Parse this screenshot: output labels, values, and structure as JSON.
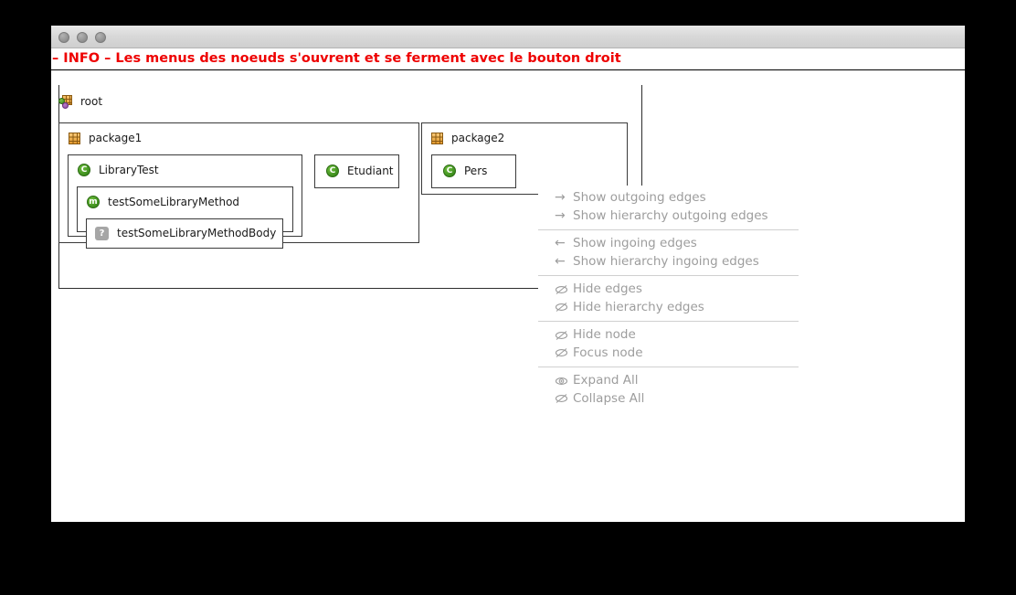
{
  "window": {
    "traffic_lights": [
      "close",
      "minimize",
      "maximize"
    ],
    "info_message": "– INFO – Les menus des noeuds s'ouvrent et se ferment avec le bouton droit",
    "info_color": "#ee0000"
  },
  "graph": {
    "nodes": [
      {
        "id": "root",
        "label": "root",
        "icon": "package-root-icon"
      },
      {
        "id": "package1",
        "label": "package1",
        "icon": "package-icon"
      },
      {
        "id": "package2",
        "label": "package2",
        "icon": "package-icon"
      },
      {
        "id": "librarytest",
        "label": "LibraryTest",
        "icon": "class-icon",
        "icon_glyph": "C"
      },
      {
        "id": "etudiant",
        "label": "Etudiant",
        "icon": "class-icon",
        "icon_glyph": "C"
      },
      {
        "id": "personne",
        "label": "Pers",
        "icon": "class-icon",
        "icon_glyph": "C"
      },
      {
        "id": "testmethod",
        "label": "testSomeLibraryMethod",
        "icon": "method-icon",
        "icon_glyph": "m"
      },
      {
        "id": "testmethodbody",
        "label": "testSomeLibraryMethodBody",
        "icon": "unknown-icon",
        "icon_glyph": "?"
      }
    ]
  },
  "context_menu": {
    "disabled_color": "#9d9d9d",
    "groups": [
      {
        "items": [
          {
            "glyph": "→",
            "icon": "arrow-right-icon",
            "label": "Show outgoing edges",
            "enabled": false
          },
          {
            "glyph": "→",
            "icon": "arrow-right-icon",
            "label": "Show hierarchy outgoing edges",
            "enabled": false
          }
        ]
      },
      {
        "items": [
          {
            "glyph": "←",
            "icon": "arrow-left-icon",
            "label": "Show ingoing edges",
            "enabled": false
          },
          {
            "glyph": "←",
            "icon": "arrow-left-icon",
            "label": "Show hierarchy ingoing edges",
            "enabled": false
          }
        ]
      },
      {
        "items": [
          {
            "glyph": "eye-slash",
            "icon": "eye-slash-icon",
            "label": "Hide edges",
            "enabled": false
          },
          {
            "glyph": "eye-slash",
            "icon": "eye-slash-icon",
            "label": "Hide hierarchy edges",
            "enabled": false
          }
        ]
      },
      {
        "items": [
          {
            "glyph": "eye-slash",
            "icon": "eye-slash-icon",
            "label": "Hide node",
            "enabled": false
          },
          {
            "glyph": "eye-slash",
            "icon": "eye-slash-icon",
            "label": "Focus node",
            "enabled": false
          }
        ]
      },
      {
        "items": [
          {
            "glyph": "eye",
            "icon": "eye-icon",
            "label": "Expand All",
            "enabled": false
          },
          {
            "glyph": "eye-slash",
            "icon": "eye-slash-icon",
            "label": "Collapse All",
            "enabled": false
          }
        ]
      }
    ]
  }
}
